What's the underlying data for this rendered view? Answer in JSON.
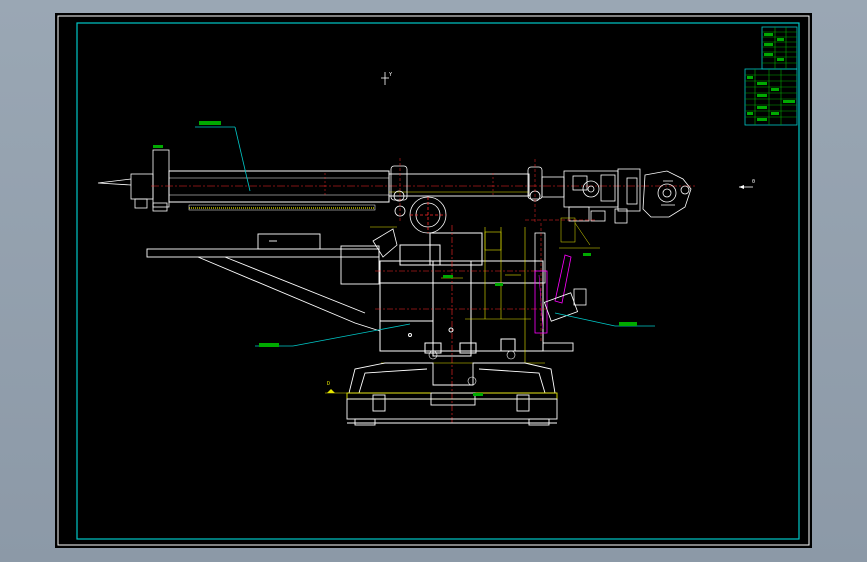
{
  "drawing": {
    "labels": {
      "direction_top": "Y",
      "direction_right": "0",
      "datum_left": "D"
    },
    "colors": {
      "background": "#000000",
      "frame": "#00c8c8",
      "outline": "#ffffff",
      "centerline": "#ff2a2a",
      "dimension": "#e6e600",
      "leader": "#00c8c8",
      "hatch": "#ff00ff",
      "annotation": "#00ff00",
      "tableFill": "#00aa00"
    }
  }
}
